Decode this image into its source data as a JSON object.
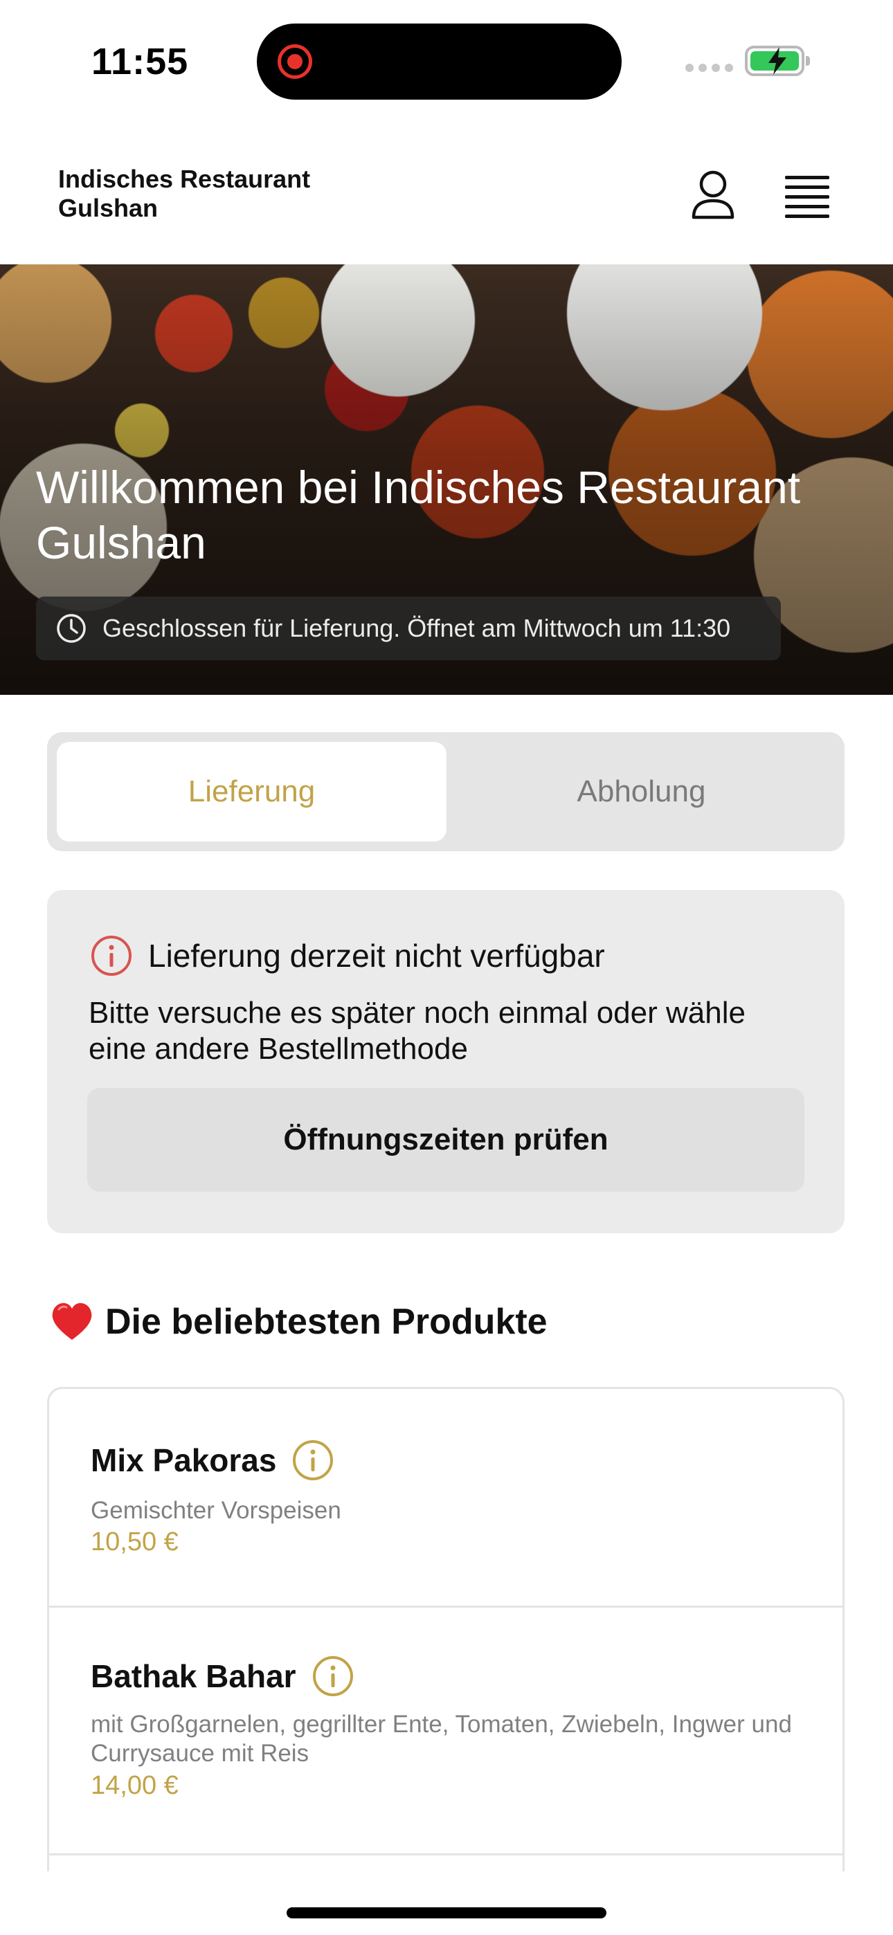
{
  "status_bar": {
    "time": "11:55"
  },
  "header": {
    "brand_line1": "Indisches Restaurant",
    "brand_line2": "Gulshan",
    "account_icon": "user-icon",
    "menu_icon": "hamburger-menu-icon"
  },
  "hero": {
    "title_line1": "Willkommen bei Indisches Restaurant",
    "title_line2": "Gulshan",
    "notice_icon": "clock-icon",
    "notice": "Geschlossen für Lieferung. Öffnet am Mittwoch um 11:30"
  },
  "order_mode": {
    "tabs": [
      {
        "label": "Lieferung",
        "selected": true
      },
      {
        "label": "Abholung",
        "selected": false
      }
    ]
  },
  "alert": {
    "icon": "info-circle-icon",
    "title": "Lieferung derzeit nicht verfügbar",
    "body": "Bitte versuche es später noch einmal oder wähle eine andere Bestellmethode",
    "button_label": "Öffnungszeiten prüfen"
  },
  "popular": {
    "heading": "Die beliebtesten Produkte",
    "heading_icon": "heart-icon",
    "products": [
      {
        "name": "Mix Pakoras",
        "description": "Gemischter Vorspeisen",
        "price": "10,50 €"
      },
      {
        "name": "Bathak Bahar",
        "description": "mit Großgarnelen, gegrillter Ente, Tomaten, Zwiebeln, Ingwer und Currysauce mit Reis",
        "price": "14,00 €"
      }
    ]
  },
  "colors": {
    "accent_gold": "#c2a347",
    "alert_red": "#d9534f",
    "card_gray": "#ebebeb"
  }
}
